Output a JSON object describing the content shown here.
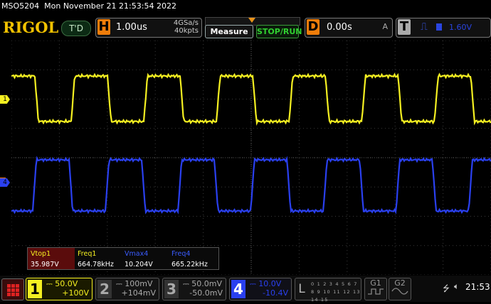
{
  "header": {
    "model": "MSO5204",
    "datetime": "Mon November 21 21:53:54 2022",
    "logo": "RIGOL",
    "trigger_status": "T'D"
  },
  "horizontal": {
    "letter": "H",
    "timebase": "1.00us",
    "sample_rate": "4GSa/s",
    "memory_depth": "40kpts"
  },
  "buttons": {
    "measure": "Measure",
    "stop_run": "STOP/RUN"
  },
  "delay": {
    "letter": "D",
    "value": "0.00s"
  },
  "trigger": {
    "letter": "T",
    "mode": "A",
    "level": "1.60V",
    "edge_icon": "rising-edge-icon",
    "color": "#2a45e0"
  },
  "channel_markers": {
    "ch1": "1",
    "ch4": "4"
  },
  "measurements": [
    {
      "label": "Vtop1",
      "value": "35.987V",
      "color": "#f5f021",
      "highlight": true
    },
    {
      "label": "Freq1",
      "value": "664.78kHz",
      "color": "#f5f021",
      "highlight": false
    },
    {
      "label": "Vmax4",
      "value": "10.204V",
      "color": "#3a5cff",
      "highlight": false
    },
    {
      "label": "Freq4",
      "value": "665.22kHz",
      "color": "#3a5cff",
      "highlight": false
    }
  ],
  "channels": [
    {
      "num": "1",
      "scale": "50.0V",
      "offset": "+100V",
      "color": "#f5f021",
      "active": true
    },
    {
      "num": "2",
      "scale": "100mV",
      "offset": "+104mV",
      "color": "#aaaaaa",
      "active": false
    },
    {
      "num": "3",
      "scale": "50.0mV",
      "offset": "-50.0mV",
      "color": "#aaaaaa",
      "active": false
    },
    {
      "num": "4",
      "scale": "10.0V",
      "offset": "-10.4V",
      "color": "#2a40f0",
      "active": true
    }
  ],
  "logic": {
    "letter": "L",
    "bits_row1": "0 1 2 3 4 5 6 7",
    "bits_row2": "8 9 10 11 12 13 14 15"
  },
  "generators": [
    "G1",
    "G2"
  ],
  "status": {
    "time": "21:53"
  },
  "waveform": {
    "ch1_color": "#f5f021",
    "ch4_color": "#2a40f0",
    "frequency_khz": 665
  }
}
